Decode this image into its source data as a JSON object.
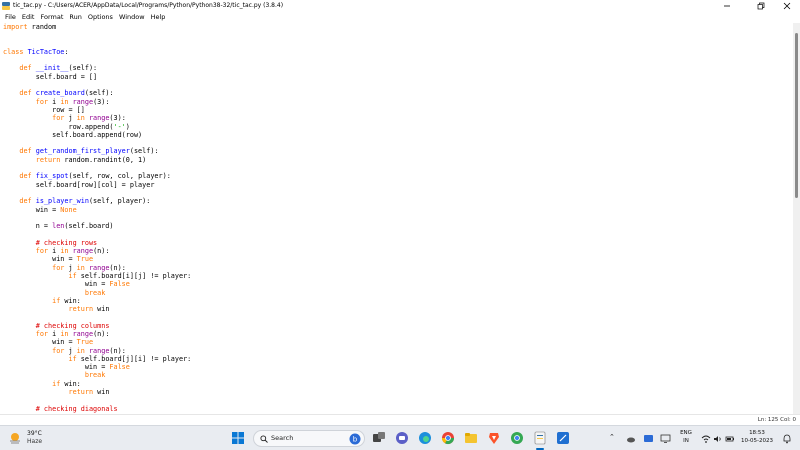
{
  "window": {
    "title": "tic_tac.py - C:/Users/ACER/AppData/Local/Programs/Python/Python38-32/tic_tac.py (3.8.4)"
  },
  "menu": [
    "File",
    "Edit",
    "Format",
    "Run",
    "Options",
    "Window",
    "Help"
  ],
  "editor": {
    "lines": [
      "import random",
      "",
      "",
      "class TicTacToe:",
      "",
      "    def __init__(self):",
      "        self.board = []",
      "",
      "    def create_board(self):",
      "        for i in range(3):",
      "            row = []",
      "            for j in range(3):",
      "                row.append('-')",
      "            self.board.append(row)",
      "",
      "    def get_random_first_player(self):",
      "        return random.randint(0, 1)",
      "",
      "    def fix_spot(self, row, col, player):",
      "        self.board[row][col] = player",
      "",
      "    def is_player_win(self, player):",
      "        win = None",
      "",
      "        n = len(self.board)",
      "",
      "        # checking rows",
      "        for i in range(n):",
      "            win = True",
      "            for j in range(n):",
      "                if self.board[i][j] != player:",
      "                    win = False",
      "                    break",
      "            if win:",
      "                return win",
      "",
      "        # checking columns",
      "        for i in range(n):",
      "            win = True",
      "            for j in range(n):",
      "                if self.board[j][i] != player:",
      "                    win = False",
      "                    break",
      "            if win:",
      "                return win",
      "",
      "        # checking diagonals"
    ]
  },
  "status": {
    "position": "Ln: 125  Col: 0"
  },
  "taskbar": {
    "weather_temp": "39°C",
    "weather_desc": "Haze",
    "search_label": "Search",
    "lang_top": "ENG",
    "lang_bottom": "IN",
    "time": "18:53",
    "date": "10-05-2023"
  },
  "colors": {
    "keyword": "#ff7700",
    "builtin": "#900090",
    "defname": "#0000ff",
    "string": "#00aa00",
    "comment": "#dd0000",
    "taskbar_accent": "#0067c0"
  }
}
